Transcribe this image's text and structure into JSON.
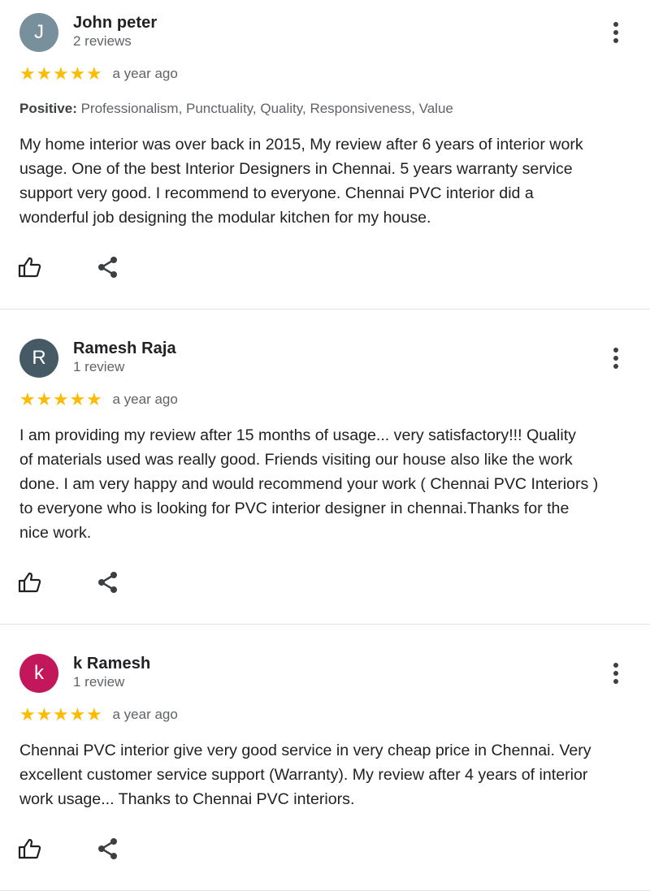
{
  "reviews": [
    {
      "initial": "J",
      "avatar_color": "#78909c",
      "name": "John peter",
      "review_count": "2 reviews",
      "rating": 5,
      "time": "a year ago",
      "positive_label": "Positive:",
      "positive_values": " Professionalism, Punctuality, Quality, Responsiveness, Value",
      "lines": [
        "My home interior was over back in 2015, My review after 6 years of interior work",
        "usage. One of the best Interior Designers in Chennai. 5 years warranty service",
        "support very good. I recommend to everyone. Chennai PVC interior did a",
        "wonderful job designing the modular kitchen for my house."
      ]
    },
    {
      "initial": "R",
      "avatar_color": "#455a64",
      "name": "Ramesh Raja",
      "review_count": "1 review",
      "rating": 5,
      "time": "a year ago",
      "lines": [
        "I am providing my review after 15 months of usage... very satisfactory!!! Quality",
        "of materials used was really good. Friends visiting our house also like the work",
        "done. I am very happy and would recommend your work ( Chennai PVC Interiors )",
        "to everyone who is looking for PVC interior designer in chennai.Thanks for the",
        "nice work."
      ]
    },
    {
      "initial": "k",
      "avatar_color": "#c2185b",
      "name": "k Ramesh",
      "review_count": "1 review",
      "rating": 5,
      "time": "a year ago",
      "lines": [
        "Chennai PVC interior give very good service in very cheap price in Chennai. Very",
        "excellent customer service support (Warranty). My review after 4 years of interior",
        "work usage... Thanks to Chennai PVC interiors."
      ]
    }
  ]
}
